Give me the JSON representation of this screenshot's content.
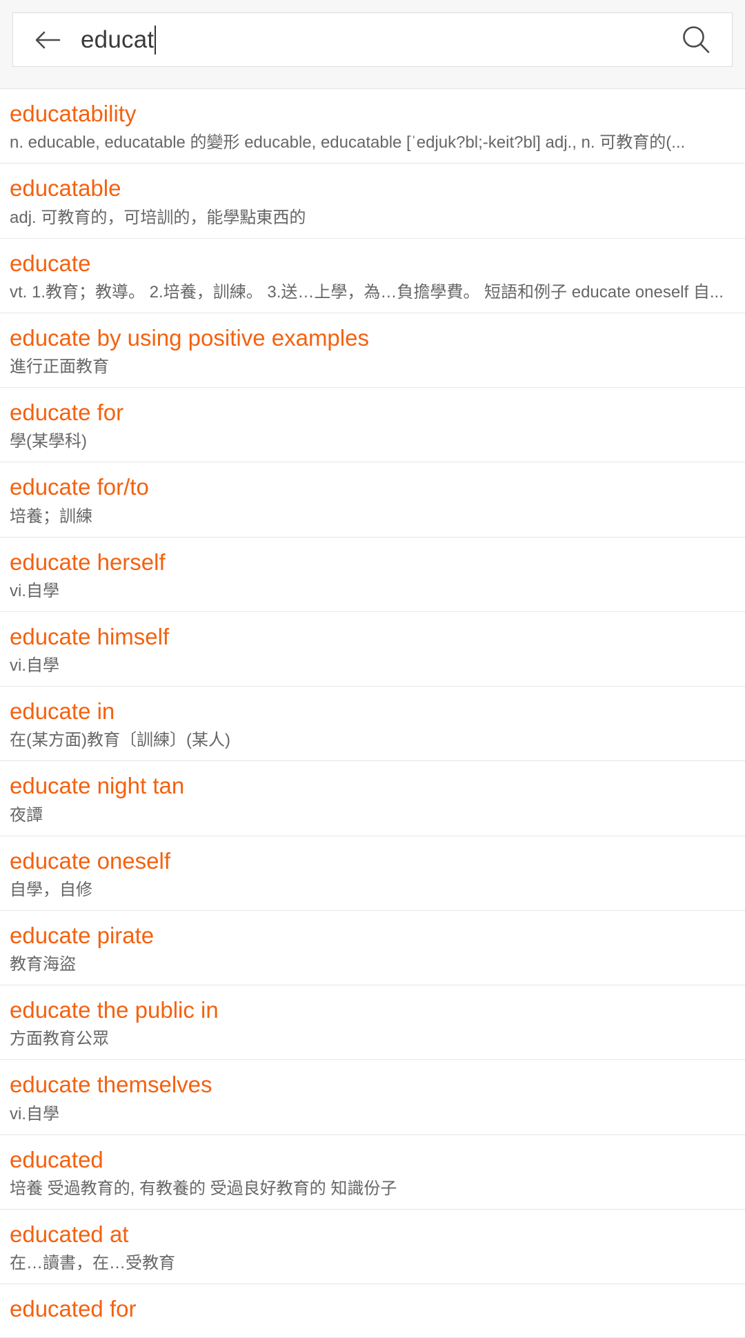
{
  "search": {
    "value": "educat",
    "placeholder": "",
    "back_icon": "back-arrow-icon",
    "submit_icon": "search-icon"
  },
  "colors": {
    "accent": "#f4610f",
    "definition_text": "#666666",
    "header_background": "#f7f7f7",
    "divider": "#e6e6e6",
    "input_text": "#3a3a3a"
  },
  "results": [
    {
      "word": "educatability",
      "definition": "n.   educable, educatable 的變形   educable, educatable   [ˈedjuk?bl;-keit?bl]   adj., n.   可教育的(..."
    },
    {
      "word": "educatable",
      "definition": "adj. 可教育的，可培訓的，能學點東西的"
    },
    {
      "word": "educate",
      "definition": "vt. 1.教育；教導。 2.培養，訓練。 3.送…上學，為…負擔學費。  短語和例子  educate oneself 自..."
    },
    {
      "word": "educate by using positive examples",
      "definition": "進行正面教育"
    },
    {
      "word": "educate for",
      "definition": "學(某學科)"
    },
    {
      "word": "educate for/to",
      "definition": "培養；訓練"
    },
    {
      "word": "educate herself",
      "definition": "vi.自學"
    },
    {
      "word": "educate himself",
      "definition": "vi.自學"
    },
    {
      "word": "educate in",
      "definition": "在(某方面)教育〔訓練〕(某人)"
    },
    {
      "word": "educate night tan",
      "definition": "夜譚"
    },
    {
      "word": "educate oneself",
      "definition": "自學，自修"
    },
    {
      "word": "educate pirate",
      "definition": "教育海盜"
    },
    {
      "word": "educate the public in",
      "definition": "方面教育公眾"
    },
    {
      "word": "educate themselves",
      "definition": "vi.自學"
    },
    {
      "word": "educated",
      "definition": "培養  受過教育的, 有教養的  受過良好教育的  知識份子"
    },
    {
      "word": "educated at",
      "definition": "在…讀書，在…受教育"
    },
    {
      "word": "educated for",
      "definition": ""
    }
  ]
}
